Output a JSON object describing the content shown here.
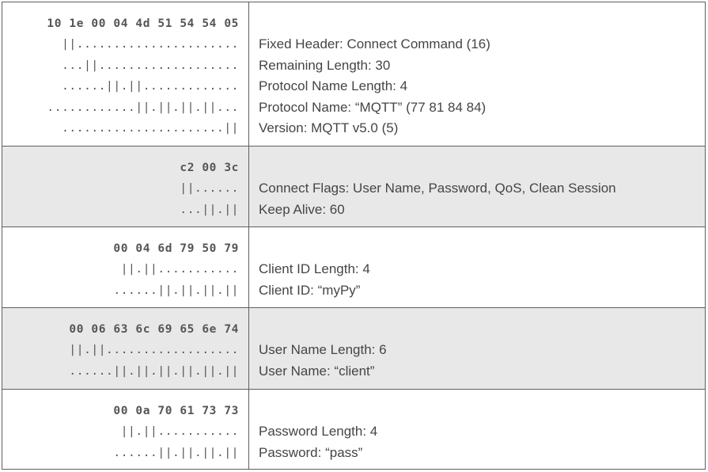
{
  "rows": [
    {
      "shaded": false,
      "height": 181,
      "hex": "10 1e 00 04 4d 51 54 54 05",
      "maps": [
        "||......................",
        "...||...................",
        "......||.||.............",
        "............||.||.||.||...",
        "......................||"
      ],
      "descriptions": [
        "Fixed Header: Connect Command (16)",
        "Remaining Length: 30",
        "Protocol Name Length: 4",
        "Protocol Name: “MQTT” (77 81 84 84)",
        "Version: MQTT v5.0 (5)"
      ]
    },
    {
      "shaded": true,
      "height": 102,
      "hex": "c2 00 3c",
      "maps": [
        "||......",
        "...||.||"
      ],
      "descriptions": [
        "Connect Flags: User Name, Password, QoS, Clean Session",
        "Keep Alive: 60"
      ]
    },
    {
      "shaded": false,
      "height": 102,
      "hex": "00 04 6d 79 50 79",
      "maps": [
        "||.||...........",
        "......||.||.||.||"
      ],
      "descriptions": [
        "Client ID Length: 4",
        "Client ID: “myPy”"
      ]
    },
    {
      "shaded": true,
      "height": 103,
      "hex": "00 06 63 6c 69 65 6e 74",
      "maps": [
        "||.||..................",
        "......||.||.||.||.||.||"
      ],
      "descriptions": [
        "User Name Length: 6",
        "User Name: “client”"
      ]
    },
    {
      "shaded": false,
      "height": 101,
      "hex": "00 0a 70 61 73 73",
      "maps": [
        "||.||...........",
        "......||.||.||.||"
      ],
      "descriptions": [
        "Password Length: 4",
        "Password: “pass”"
      ]
    }
  ]
}
